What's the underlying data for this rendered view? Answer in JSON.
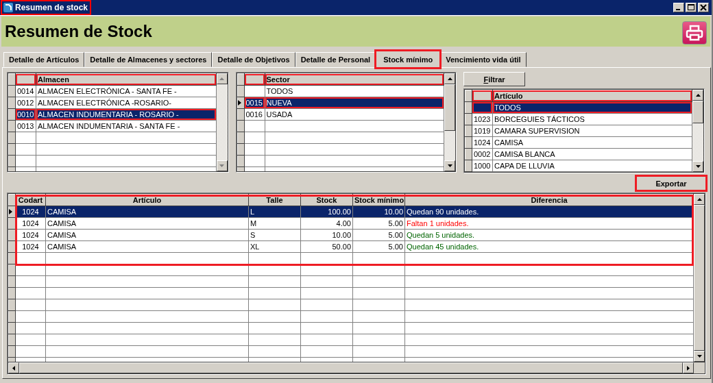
{
  "window": {
    "title": "Resumen de stock",
    "highlighted": true
  },
  "header": {
    "title": "Resumen de Stock"
  },
  "tabs": [
    {
      "label": "Detalle de Artículos",
      "selected": false,
      "highlighted": false
    },
    {
      "label": "Detalle de Almacenes y sectores",
      "selected": false,
      "highlighted": false
    },
    {
      "label": "Detalle de Objetivos",
      "selected": false,
      "highlighted": false
    },
    {
      "label": "Detalle de Personal",
      "selected": false,
      "highlighted": false
    },
    {
      "label": "Stock mínimo",
      "selected": true,
      "highlighted": true
    },
    {
      "label": "Vencimiento vida útil",
      "selected": false,
      "highlighted": false
    }
  ],
  "almacen_grid": {
    "header_highlighted": true,
    "columns": [
      {},
      {
        "label": "Almacen"
      }
    ],
    "rows": [
      {
        "cells": [
          "0014",
          "ALMACEN ELECTRÓNICA - SANTA FE -"
        ],
        "selected": false,
        "current": false,
        "highlighted": false
      },
      {
        "cells": [
          "0012",
          "ALMACEN ELECTRÓNICA -ROSARIO-"
        ],
        "selected": false,
        "current": false,
        "highlighted": false
      },
      {
        "cells": [
          "0010",
          "ALMACEN INDUMENTARIA - ROSARIO -"
        ],
        "selected": true,
        "current": false,
        "highlighted": true
      },
      {
        "cells": [
          "0013",
          "ALMACEN INDUMENTARIA - SANTA FE -"
        ],
        "selected": false,
        "current": false,
        "highlighted": false
      }
    ]
  },
  "sector_grid": {
    "header_highlighted": true,
    "columns": [
      {},
      {
        "label": "Sector"
      }
    ],
    "rows": [
      {
        "cells": [
          "",
          "TODOS"
        ],
        "selected": false,
        "current": false,
        "highlighted": false
      },
      {
        "cells": [
          "0015",
          "NUEVA"
        ],
        "selected": true,
        "current": true,
        "highlighted": true
      },
      {
        "cells": [
          "0016",
          "USADA"
        ],
        "selected": false,
        "current": false,
        "highlighted": false
      }
    ]
  },
  "filter_button": {
    "label": "Filtrar"
  },
  "articulo_grid": {
    "header_highlighted": true,
    "columns": [
      {},
      {
        "label": "Artículo"
      }
    ],
    "rows": [
      {
        "cells": [
          "",
          "TODOS"
        ],
        "selected": true,
        "current": false,
        "highlighted": true
      },
      {
        "cells": [
          "1023",
          "BORCEGUIES TÁCTICOS"
        ],
        "selected": false,
        "current": false,
        "highlighted": false
      },
      {
        "cells": [
          "1019",
          "CAMARA SUPERVISION"
        ],
        "selected": false,
        "current": false,
        "highlighted": false
      },
      {
        "cells": [
          "1024",
          "CAMISA"
        ],
        "selected": false,
        "current": false,
        "highlighted": false
      },
      {
        "cells": [
          "0002",
          "CAMISA BLANCA"
        ],
        "selected": false,
        "current": false,
        "highlighted": false
      },
      {
        "cells": [
          "1000",
          "CAPA DE LLUVIA"
        ],
        "selected": false,
        "current": false,
        "highlighted": false
      }
    ]
  },
  "export_button": {
    "label": "Exportar",
    "highlighted": true
  },
  "result_table": {
    "highlighted": true,
    "columns": [
      {
        "label": "Codart"
      },
      {
        "label": "Artículo"
      },
      {
        "label": "Talle"
      },
      {
        "label": "Stock"
      },
      {
        "label": "Stock mínimo"
      },
      {
        "label": "Diferencia"
      }
    ],
    "rows": [
      {
        "cells": [
          "1024",
          "CAMISA",
          "L",
          "100.00",
          "10.00",
          "Quedan 90 unidades."
        ],
        "selected": true,
        "current": true
      },
      {
        "cells": [
          "1024",
          "CAMISA",
          "M",
          "4.00",
          "5.00",
          "Faltan 1 unidades."
        ],
        "selected": false,
        "current": false,
        "color": "#ff0000"
      },
      {
        "cells": [
          "1024",
          "CAMISA",
          "S",
          "10.00",
          "5.00",
          "Quedan 5 unidades."
        ],
        "selected": false,
        "current": false,
        "color": "#006400"
      },
      {
        "cells": [
          "1024",
          "CAMISA",
          "XL",
          "50.00",
          "5.00",
          "Quedan 45 unidades."
        ],
        "selected": false,
        "current": false,
        "color": "#006400"
      }
    ]
  }
}
